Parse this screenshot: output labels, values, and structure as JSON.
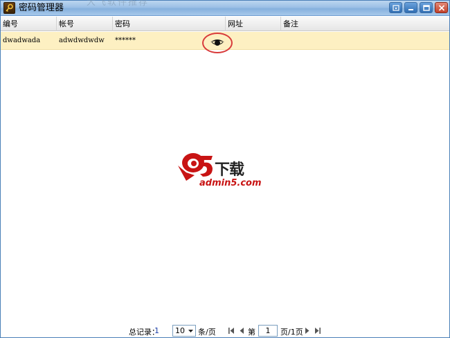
{
  "window": {
    "title": "密码管理器",
    "ghost_title": "大飞软件推荐"
  },
  "table": {
    "columns": [
      "编号",
      "帐号",
      "密码",
      "网址",
      "备注"
    ],
    "rows": [
      {
        "id": "dwadwada",
        "account": "adwdwdwdw",
        "password": "******",
        "url": "",
        "note": ""
      }
    ]
  },
  "watermark": {
    "mark": "a5",
    "brand_cn": "下载",
    "brand_url": "admin5.com"
  },
  "pager": {
    "total_label": "总记录：",
    "total_value": "1",
    "page_size": "10",
    "per_label": "条/页",
    "page_label": "第",
    "current_page": "1",
    "pages_label": "页/1页"
  },
  "icons": {
    "app": "key-icon",
    "eye": "eye-icon",
    "first": "first-page-icon",
    "prev": "prev-page-icon",
    "next": "next-page-icon",
    "last": "last-page-icon"
  },
  "colors": {
    "titlebar": "#9cc0e6",
    "row_selected": "#fdf0c2",
    "highlight_ring": "#d83a3a",
    "total_value": "#1a3da8",
    "logo_red": "#c81414"
  }
}
